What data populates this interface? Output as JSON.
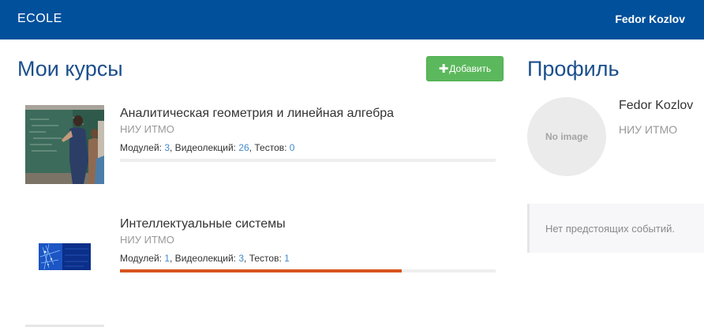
{
  "navbar": {
    "brand": "ECOLE",
    "user": "Fedor Kozlov"
  },
  "courses_section": {
    "title": "Мои курсы",
    "add_button": "Добавить",
    "courses": [
      {
        "title": "Аналитическая геометрия и линейная алгебра",
        "org": "НИУ ИТМО",
        "modules_label": "Модулей: ",
        "modules": "3",
        "videos_label": ", Видеолекций: ",
        "videos": "26",
        "tests_label": ", Тестов: ",
        "tests": "0",
        "progress": 0,
        "thumbnail": "classroom-blackboard-photo"
      },
      {
        "title": "Интеллектуальные системы",
        "org": "НИУ ИТМО",
        "modules_label": "Модулей: ",
        "modules": "1",
        "videos_label": ", Видеолекций: ",
        "videos": "3",
        "tests_label": ", Тестов: ",
        "tests": "1",
        "progress": 0.75,
        "thumbnail": "blue-neural-network-graphic"
      }
    ]
  },
  "profile": {
    "title": "Профиль",
    "avatar_text": "No image",
    "name": "Fedor Kozlov",
    "org": "НИУ ИТМО"
  },
  "events": {
    "empty_text": "Нет предстоящих событий."
  },
  "colors": {
    "navbar": "#00509b",
    "title": "#1b4f8c",
    "add_button": "#5cb85c",
    "progress": "#d9541e",
    "link": "#428bca"
  }
}
